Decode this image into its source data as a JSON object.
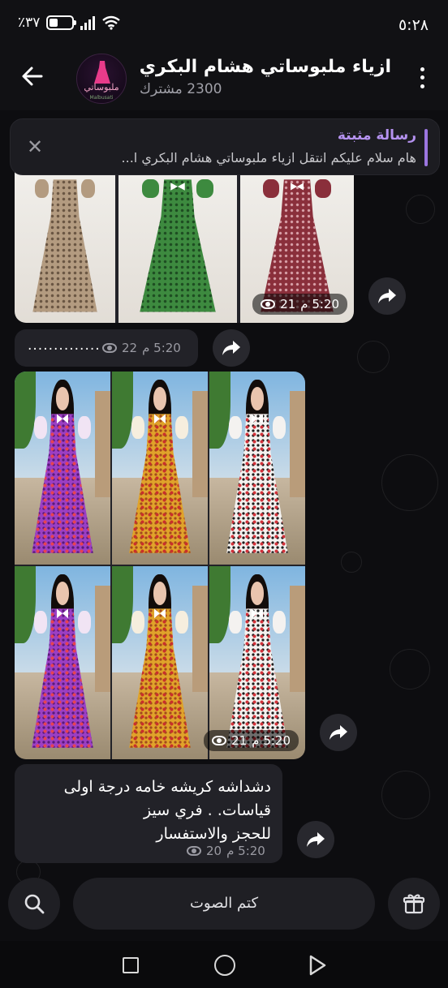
{
  "status_bar": {
    "time": "٥:٢٨",
    "battery": "٪٣٧",
    "battery_level": 0.37
  },
  "header": {
    "title": "ازياء ملبوساتي هشام البكري",
    "subscribers": "2300 مشترك",
    "avatar_text": "ملبوساتي",
    "avatar_subtext": "Malbusati"
  },
  "pinned": {
    "title": "رسالة مثبتة",
    "text": "هام  سلام عليكم انتقل ازياء ملبوساتي هشام البكري ا..."
  },
  "messages": [
    {
      "type": "album",
      "time": "5:20 م",
      "views": "21"
    },
    {
      "type": "text",
      "text": "..............",
      "time": "5:20 م",
      "views": "22"
    },
    {
      "type": "album",
      "time": "5:20 م",
      "views": "21"
    },
    {
      "type": "text",
      "lines": [
        "دشداشه كريشه خامه درجة اولى",
        "قياسات. . فري سيز",
        "للحجز والاستفسار"
      ],
      "time": "5:20 م",
      "views": "20"
    }
  ],
  "bottom": {
    "mute_label": "كتم الصوت"
  },
  "colors": {
    "accent": "#9b76e0",
    "background": "#0d0d10",
    "bubble": "#222228"
  },
  "icons": [
    "back-arrow-icon",
    "menu-icon",
    "close-icon",
    "forward-icon",
    "eye-icon",
    "search-icon",
    "gift-icon"
  ]
}
